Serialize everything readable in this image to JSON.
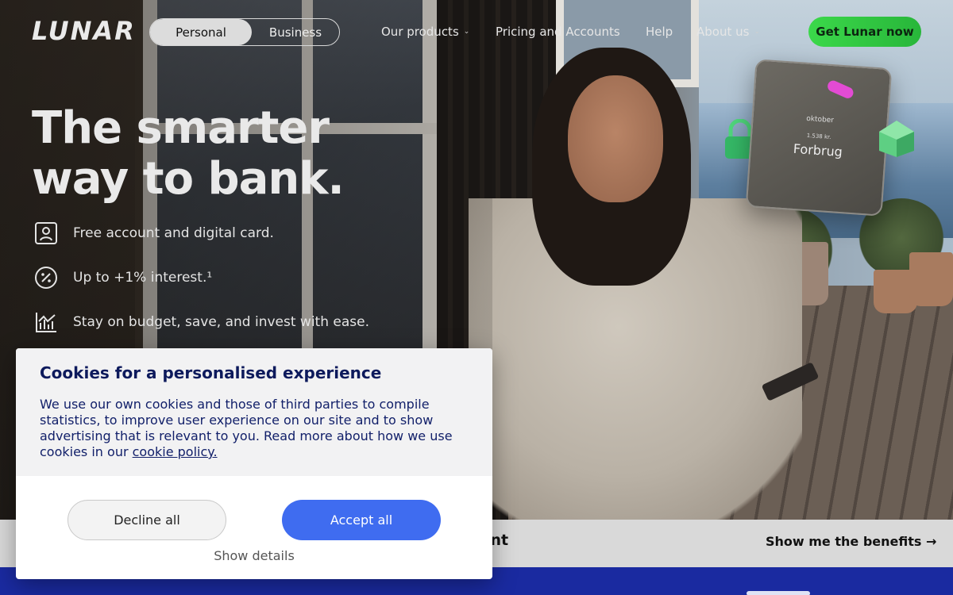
{
  "header": {
    "logo": "LUNAR",
    "segments": [
      {
        "label": "Personal",
        "active": true
      },
      {
        "label": "Business",
        "active": false
      }
    ],
    "nav": [
      {
        "label": "Our products",
        "has_dropdown": true
      },
      {
        "label": "Pricing and Accounts",
        "has_dropdown": false
      },
      {
        "label": "Help",
        "has_dropdown": false
      },
      {
        "label": "About us",
        "has_dropdown": true
      }
    ],
    "cta": "Get Lunar now"
  },
  "hero": {
    "headline_line1": "The smarter",
    "headline_line2": "way to bank.",
    "features": [
      {
        "icon": "id-card-icon",
        "text": "Free account and digital card."
      },
      {
        "icon": "percent-icon",
        "text": "Up to +1% interest.¹"
      },
      {
        "icon": "bar-chart-icon",
        "text": "Stay on budget, save, and invest with ease."
      }
    ],
    "floating_card": {
      "month": "oktober",
      "amount": "1.538 kr.",
      "label": "Forbrug"
    }
  },
  "strip": {
    "partial_text": "unt",
    "link": "Show me the benefits →"
  },
  "cookie": {
    "title": "Cookies for a personalised experience",
    "body": "We use our own cookies and those of third parties to compile statistics, to improve user experience on our site and to show advertising that is relevant to you. Read more about how we use cookies in our ",
    "link": "cookie policy.",
    "decline": "Decline all",
    "accept": "Accept all",
    "details": "Show details"
  },
  "colors": {
    "accent_green": "#2bc43d",
    "accent_blue": "#3f6cf0",
    "navy_text": "#0d1a5c",
    "band_blue": "#1a2aa0"
  }
}
